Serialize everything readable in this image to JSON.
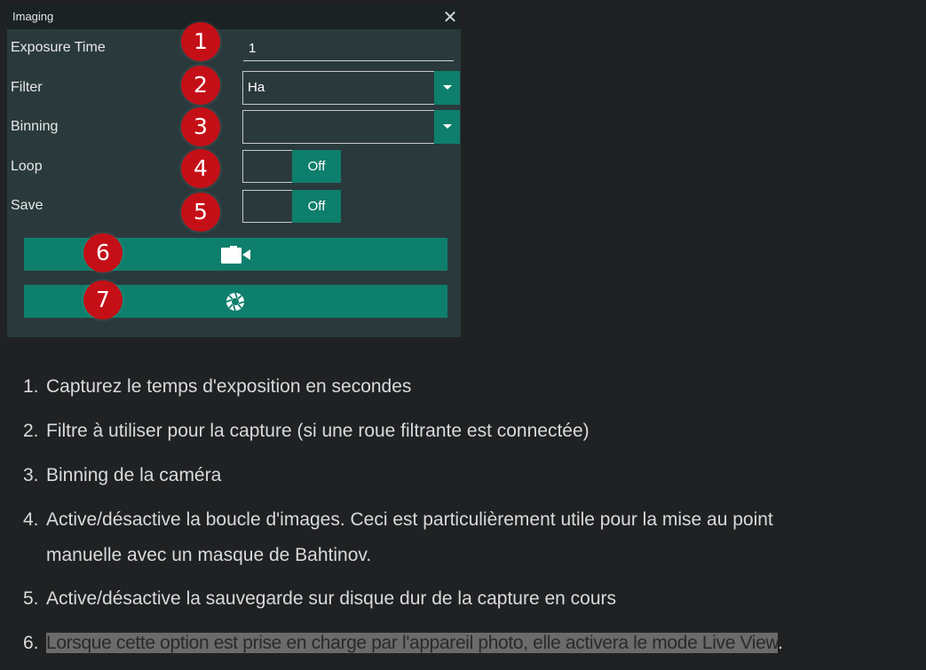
{
  "panel": {
    "title": "Imaging",
    "close_glyph": "✕",
    "rows": {
      "exposure": {
        "label": "Exposure Time",
        "value": "1"
      },
      "filter": {
        "label": "Filter",
        "value": "Ha"
      },
      "binning": {
        "label": "Binning",
        "value": ""
      },
      "loop": {
        "label": "Loop",
        "state": "Off"
      },
      "save": {
        "label": "Save",
        "state": "Off"
      }
    },
    "buttons": {
      "live_view_icon": "video-camera-icon",
      "capture_icon": "camera-shutter-icon"
    },
    "badges": [
      "1",
      "2",
      "3",
      "4",
      "5",
      "6",
      "7"
    ],
    "accent_color": "#0e7f6c",
    "badge_color": "#c50f17"
  },
  "list": {
    "items": [
      {
        "num": "1.",
        "text": "Capturez le temps d'exposition en secondes"
      },
      {
        "num": "2.",
        "text": "Filtre à utiliser pour la capture (si une roue filtrante est connectée)"
      },
      {
        "num": "3.",
        "text": "Binning de la caméra"
      },
      {
        "num": "4.",
        "text": "Active/désactive la boucle d'images. Ceci est particulièrement utile pour la mise au point",
        "text2": "manuelle avec un masque de Bahtinov."
      },
      {
        "num": "5.",
        "text": "Active/désactive la sauvegarde sur disque dur de la capture en cours"
      },
      {
        "num": "6.",
        "text": "Lorsque cette option est prise en charge par l'appareil photo, elle activera le mode Live View",
        "tail": "."
      }
    ]
  }
}
